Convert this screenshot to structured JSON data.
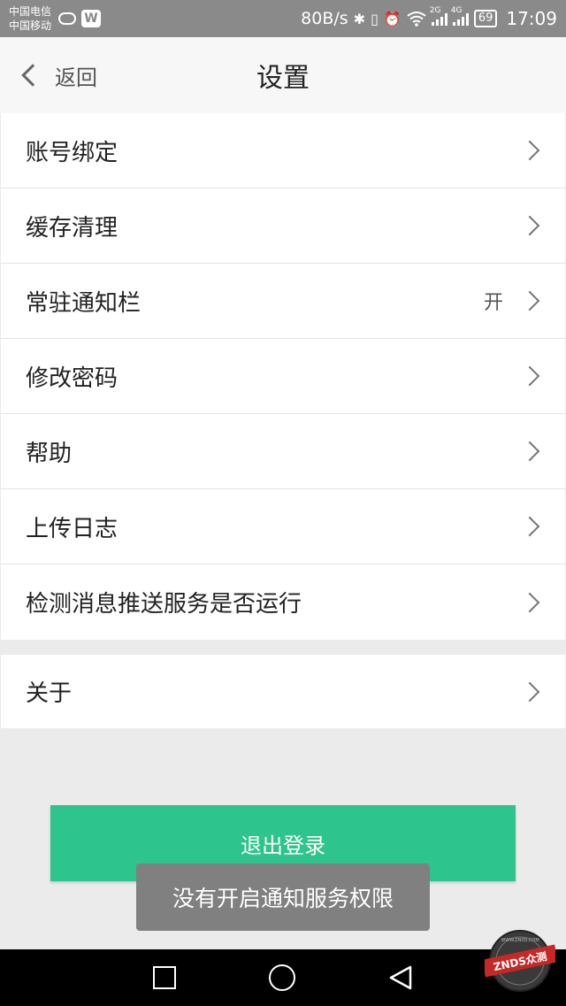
{
  "status_bar": {
    "carrier_1": "中国电信",
    "carrier_2": "中国移动",
    "net_speed": "80B/s",
    "signal_tag_1": "2G",
    "signal_tag_2": "4G",
    "battery": "69",
    "time": "17:09"
  },
  "header": {
    "back_label": "返回",
    "title": "设置"
  },
  "settings": {
    "items": [
      {
        "label": "账号绑定",
        "value": ""
      },
      {
        "label": "缓存清理",
        "value": ""
      },
      {
        "label": "常驻通知栏",
        "value": "开"
      },
      {
        "label": "修改密码",
        "value": ""
      },
      {
        "label": "帮助",
        "value": ""
      },
      {
        "label": "上传日志",
        "value": ""
      },
      {
        "label": "检测消息推送服务是否运行",
        "value": ""
      }
    ],
    "about": {
      "label": "关于"
    }
  },
  "logout_label": "退出登录",
  "toast_text": "没有开启通知服务权限",
  "watermark": {
    "text": "ZNDS众测",
    "subtext": "WWW.ZNDS.COM"
  },
  "colors": {
    "accent": "#2dc48d",
    "status_bar": "#8a8a8a",
    "toast": "#808080"
  }
}
